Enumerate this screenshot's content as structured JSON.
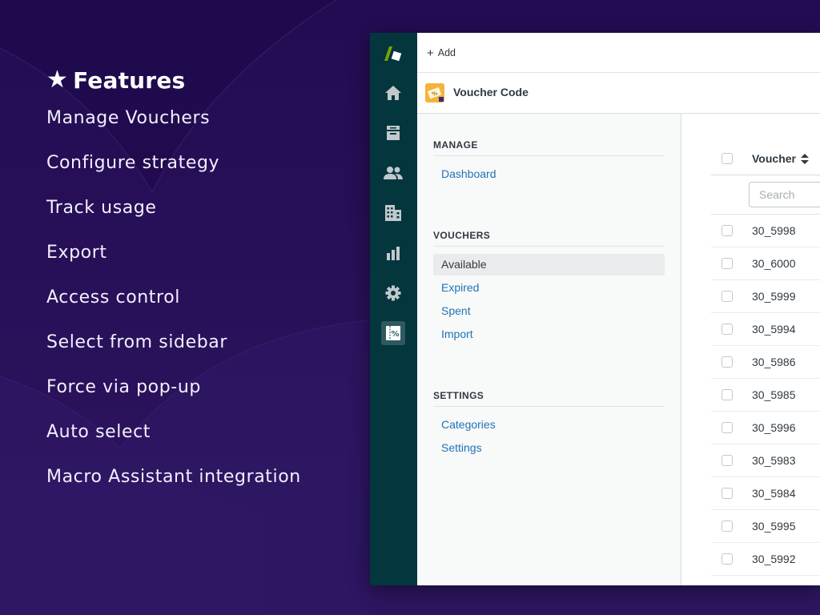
{
  "features": {
    "title": "Features",
    "star": "★",
    "items": [
      "Manage Vouchers",
      "Configure strategy",
      "Track usage",
      "Export",
      "Access control",
      "Select from sidebar",
      "Force via pop-up",
      "Auto select",
      "Macro Assistant integration"
    ]
  },
  "colors": {
    "background": "#2a1358",
    "rail": "#03363d",
    "link": "#1f73b7",
    "text": "#2f3941"
  },
  "rail": {
    "icons": [
      "zendesk-logo-icon",
      "home-icon",
      "inbox-icon",
      "users-icon",
      "building-icon",
      "bar-chart-icon",
      "gear-icon",
      "voucher-app-icon"
    ],
    "active": "voucher-app-icon"
  },
  "topbar": {
    "add_label": "Add"
  },
  "app": {
    "title": "Voucher Code"
  },
  "nav": {
    "sections": [
      {
        "heading": "MANAGE",
        "items": [
          {
            "label": "Dashboard",
            "active": false
          }
        ]
      },
      {
        "heading": "VOUCHERS",
        "items": [
          {
            "label": "Available",
            "active": true
          },
          {
            "label": "Expired",
            "active": false
          },
          {
            "label": "Spent",
            "active": false
          },
          {
            "label": "Import",
            "active": false
          }
        ]
      },
      {
        "heading": "SETTINGS",
        "items": [
          {
            "label": "Categories",
            "active": false
          },
          {
            "label": "Settings",
            "active": false
          }
        ]
      }
    ]
  },
  "table": {
    "column_header": "Voucher",
    "search_placeholder": "Search",
    "rows": [
      "30_5998",
      "30_6000",
      "30_5999",
      "30_5994",
      "30_5986",
      "30_5985",
      "30_5996",
      "30_5983",
      "30_5984",
      "30_5995",
      "30_5992"
    ]
  }
}
